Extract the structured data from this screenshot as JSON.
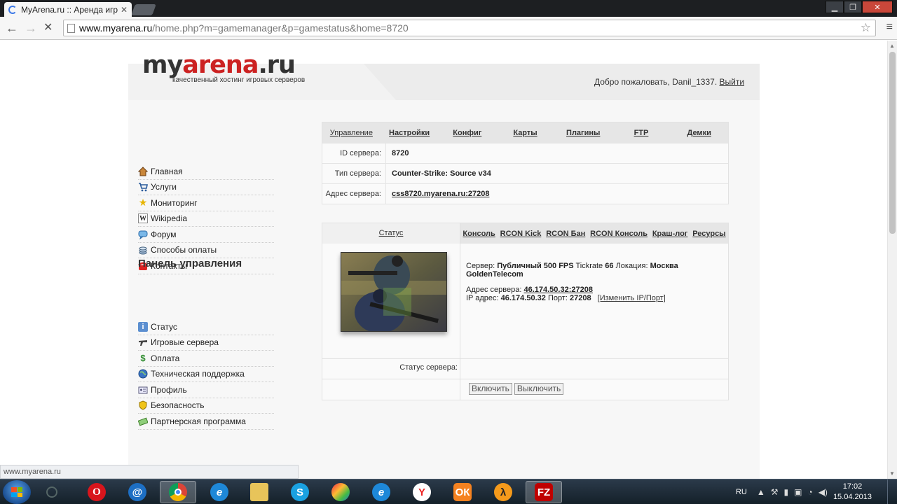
{
  "browser": {
    "tab_title": "MyArena.ru :: Аренда игр",
    "url_host": "www.myarena.ru",
    "url_path": "/home.php?m=gamemanager&p=gamestatus&home=8720",
    "status_url": "www.myarena.ru"
  },
  "header": {
    "logo_my": "my",
    "logo_arena": "arena",
    "logo_ru": ".ru",
    "tagline": "качественный хостинг игровых серверов",
    "welcome": "Добро пожаловать, Danil_1337.",
    "logout": "Выйти"
  },
  "sidebar": {
    "main_items": [
      {
        "label": "Главная",
        "icon": "home-icon"
      },
      {
        "label": "Услуги",
        "icon": "cart-icon"
      },
      {
        "label": "Мониторинг",
        "icon": "star-icon"
      },
      {
        "label": "Wikipedia",
        "icon": "wikipedia-icon"
      },
      {
        "label": "Форум",
        "icon": "speech-bubble-icon"
      },
      {
        "label": "Способы оплаты",
        "icon": "payment-icon"
      },
      {
        "label": "Контакты",
        "icon": "phone-icon"
      }
    ],
    "panel_title": "Панель управления",
    "panel_items": [
      {
        "label": "Статус",
        "icon": "info-icon"
      },
      {
        "label": "Игровые сервера",
        "icon": "gun-icon"
      },
      {
        "label": "Оплата",
        "icon": "money-icon"
      },
      {
        "label": "Техническая поддержка",
        "icon": "globe-icon"
      },
      {
        "label": "Профиль",
        "icon": "id-card-icon"
      },
      {
        "label": "Безопасность",
        "icon": "shield-icon"
      },
      {
        "label": "Партнерская программа",
        "icon": "banknote-icon"
      }
    ]
  },
  "server_tabs": [
    "Управление",
    "Настройки",
    "Конфиг",
    "Карты",
    "Плагины",
    "FTP",
    "Демки"
  ],
  "server_info": {
    "id_label": "ID сервера:",
    "id_value": "8720",
    "type_label": "Тип сервера:",
    "type_value": "Counter-Strike: Source v34",
    "address_label": "Адрес сервера:",
    "address_value": "css8720.myarena.ru:27208"
  },
  "status_tabs": {
    "first": "Статус",
    "items": [
      "Консоль",
      "RCON Kick",
      "RCON Бан",
      "RCON Консоль",
      "Краш-лог",
      "Ресурсы"
    ]
  },
  "status_panel": {
    "server_label": "Сервер:",
    "server_name": "Публичный 500 FPS",
    "tickrate_label": "Tickrate",
    "tickrate_value": "66",
    "location_label": "Локация:",
    "location_value": "Москва GoldenTelecom",
    "address_label": "Адрес сервера:",
    "address_value": "46.174.50.32:27208",
    "ip_label": "IP адрес:",
    "ip_value": "46.174.50.32",
    "port_label": "Порт:",
    "port_value": "27208",
    "change_link": "[Изменить IP/Порт]",
    "server_status_label": "Статус сервера:",
    "start_button": "Включить",
    "stop_button": "Выключить"
  },
  "taskbar": {
    "lang": "RU",
    "time": "17:02",
    "date": "15.04.2013"
  }
}
